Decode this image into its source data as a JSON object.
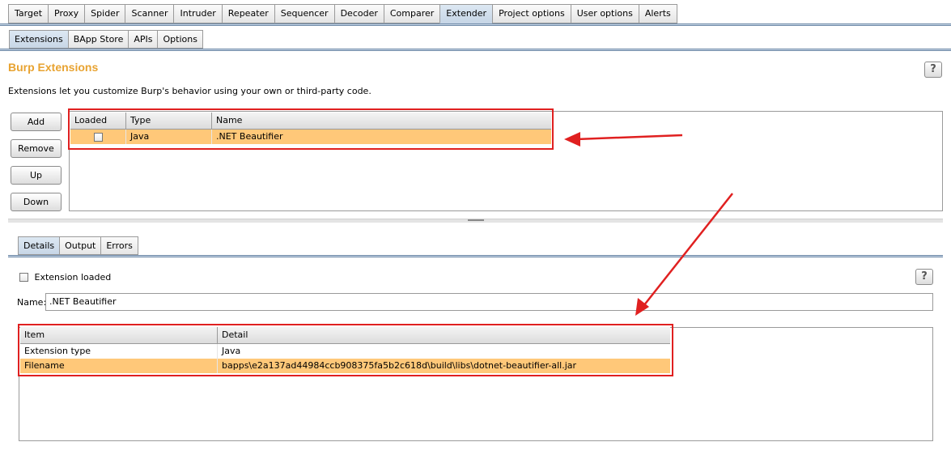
{
  "top_tabs": [
    "Target",
    "Proxy",
    "Spider",
    "Scanner",
    "Intruder",
    "Repeater",
    "Sequencer",
    "Decoder",
    "Comparer",
    "Extender",
    "Project options",
    "User options",
    "Alerts"
  ],
  "top_tab_active": "Extender",
  "sub_tabs": [
    "Extensions",
    "BApp Store",
    "APIs",
    "Options"
  ],
  "sub_tab_active": "Extensions",
  "section": {
    "title": "Burp Extensions",
    "description": "Extensions let you customize Burp's behavior using your own or third-party code.",
    "help_label": "?"
  },
  "buttons": {
    "add": "Add",
    "remove": "Remove",
    "up": "Up",
    "down": "Down"
  },
  "extensions_table": {
    "headers": [
      "Loaded",
      "Type",
      "Name"
    ],
    "rows": [
      {
        "loaded": false,
        "type": "Java",
        "name": ".NET Beautifier"
      }
    ]
  },
  "detail_tabs": [
    "Details",
    "Output",
    "Errors"
  ],
  "detail_tab_active": "Details",
  "details": {
    "extension_loaded_label": "Extension loaded",
    "name_label": "Name:",
    "name_value": ".NET Beautifier",
    "help_label": "?",
    "table": {
      "headers": [
        "Item",
        "Detail"
      ],
      "rows": [
        {
          "item": "Extension type",
          "detail": "Java"
        },
        {
          "item": "Filename",
          "detail": "bapps\\e2a137ad44984ccb908375fa5b2c618d\\build\\libs\\dotnet-beautifier-all.jar"
        }
      ]
    }
  },
  "colors": {
    "title_orange": "#e8a331",
    "selection": "#ffc879",
    "annotation_red": "#e02020"
  },
  "icons": {
    "help": "help-icon",
    "checkbox": "checkbox"
  }
}
